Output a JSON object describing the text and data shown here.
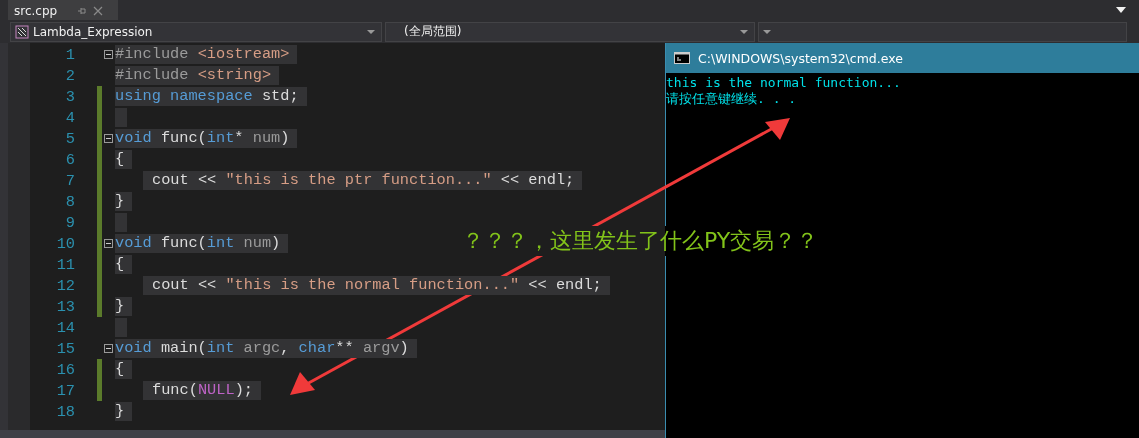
{
  "tab": {
    "title": "src.cpp"
  },
  "navigation": {
    "project": "Lambda_Expression",
    "scope": "(全局范围)"
  },
  "editor": {
    "lines": [
      {
        "number": "1",
        "changed": false,
        "collapsible": true,
        "indented": false,
        "tokens": [
          {
            "kind": "preproc",
            "text": "#include "
          },
          {
            "kind": "include",
            "text": "<iostream>"
          }
        ]
      },
      {
        "number": "2",
        "changed": false,
        "collapsible": false,
        "indented": false,
        "tokens": [
          {
            "kind": "preproc",
            "text": "#include "
          },
          {
            "kind": "include",
            "text": "<string>"
          }
        ]
      },
      {
        "number": "3",
        "changed": true,
        "collapsible": false,
        "indented": false,
        "tokens": [
          {
            "kind": "keyword",
            "text": "using namespace"
          },
          {
            "kind": "plain",
            "text": " std;"
          }
        ]
      },
      {
        "number": "4",
        "changed": true,
        "collapsible": false,
        "indented": false
      },
      {
        "number": "5",
        "changed": true,
        "collapsible": true,
        "indented": false,
        "tokens": [
          {
            "kind": "keyword",
            "text": "void"
          },
          {
            "kind": "plain",
            "text": " func("
          },
          {
            "kind": "keyword",
            "text": "int"
          },
          {
            "kind": "plain",
            "text": "*"
          },
          {
            "kind": "param",
            "text": " num"
          },
          {
            "kind": "plain",
            "text": ")"
          }
        ]
      },
      {
        "number": "6",
        "changed": true,
        "collapsible": false,
        "indented": false,
        "tokens": [
          {
            "kind": "plain",
            "text": "{"
          }
        ]
      },
      {
        "number": "7",
        "changed": true,
        "collapsible": false,
        "indented": true,
        "tokens": [
          {
            "kind": "plain",
            "text": "cout << "
          },
          {
            "kind": "string",
            "text": "\"this is the ptr function...\""
          },
          {
            "kind": "plain",
            "text": " << endl;"
          }
        ]
      },
      {
        "number": "8",
        "changed": true,
        "collapsible": false,
        "indented": false,
        "tokens": [
          {
            "kind": "plain",
            "text": "}"
          }
        ]
      },
      {
        "number": "9",
        "changed": true,
        "collapsible": false,
        "indented": false
      },
      {
        "number": "10",
        "changed": true,
        "collapsible": true,
        "indented": false,
        "tokens": [
          {
            "kind": "keyword",
            "text": "void"
          },
          {
            "kind": "plain",
            "text": " func("
          },
          {
            "kind": "keyword",
            "text": "int"
          },
          {
            "kind": "param",
            "text": " num"
          },
          {
            "kind": "plain",
            "text": ")"
          }
        ]
      },
      {
        "number": "11",
        "changed": true,
        "collapsible": false,
        "indented": false,
        "tokens": [
          {
            "kind": "plain",
            "text": "{"
          }
        ]
      },
      {
        "number": "12",
        "changed": true,
        "collapsible": false,
        "indented": true,
        "tokens": [
          {
            "kind": "plain",
            "text": "cout << "
          },
          {
            "kind": "string",
            "text": "\"this is the normal function...\""
          },
          {
            "kind": "plain",
            "text": " << endl;"
          }
        ]
      },
      {
        "number": "13",
        "changed": true,
        "collapsible": false,
        "indented": false,
        "tokens": [
          {
            "kind": "plain",
            "text": "}"
          }
        ]
      },
      {
        "number": "14",
        "changed": false,
        "collapsible": false,
        "indented": false
      },
      {
        "number": "15",
        "changed": false,
        "collapsible": true,
        "indented": false,
        "tokens": [
          {
            "kind": "keyword",
            "text": "void"
          },
          {
            "kind": "plain",
            "text": " main("
          },
          {
            "kind": "keyword",
            "text": "int"
          },
          {
            "kind": "param",
            "text": " argc"
          },
          {
            "kind": "plain",
            "text": ", "
          },
          {
            "kind": "keyword",
            "text": "char"
          },
          {
            "kind": "plain",
            "text": "** "
          },
          {
            "kind": "param",
            "text": "argv"
          },
          {
            "kind": "plain",
            "text": ")"
          }
        ]
      },
      {
        "number": "16",
        "changed": true,
        "collapsible": false,
        "indented": false,
        "tokens": [
          {
            "kind": "plain",
            "text": "{"
          }
        ]
      },
      {
        "number": "17",
        "changed": true,
        "collapsible": false,
        "indented": true,
        "tokens": [
          {
            "kind": "plain",
            "text": "func("
          },
          {
            "kind": "macro",
            "text": "NULL"
          },
          {
            "kind": "plain",
            "text": ");"
          }
        ]
      },
      {
        "number": "18",
        "changed": false,
        "collapsible": false,
        "indented": false,
        "tokens": [
          {
            "kind": "plain",
            "text": "}"
          }
        ]
      }
    ]
  },
  "console": {
    "title": "C:\\WINDOWS\\system32\\cmd.exe",
    "lines": [
      "this is the normal function...",
      "请按任意键继续. . ."
    ]
  },
  "annotation": {
    "text": "？？？，这里发生了什么PY交易？？"
  }
}
